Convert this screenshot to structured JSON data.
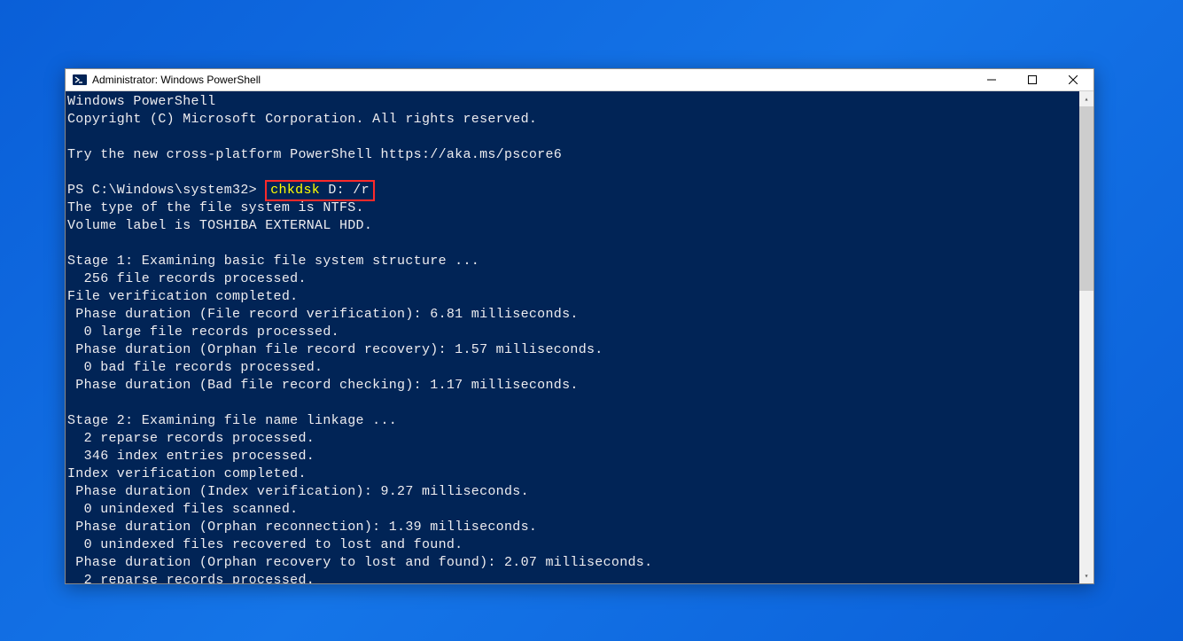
{
  "window": {
    "title": "Administrator: Windows PowerShell"
  },
  "terminal": {
    "line1": "Windows PowerShell",
    "line2": "Copyright (C) Microsoft Corporation. All rights reserved.",
    "line3": "Try the new cross-platform PowerShell https://aka.ms/pscore6",
    "prompt": "PS C:\\Windows\\system32> ",
    "cmd_name": "chkdsk",
    "cmd_args": " D: /r",
    "out1": "The type of the file system is NTFS.",
    "out2": "Volume label is TOSHIBA EXTERNAL HDD.",
    "s1_title": "Stage 1: Examining basic file system structure ...",
    "s1_l1": "  256 file records processed.",
    "s1_l2": "File verification completed.",
    "s1_l3": " Phase duration (File record verification): 6.81 milliseconds.",
    "s1_l4": "  0 large file records processed.",
    "s1_l5": " Phase duration (Orphan file record recovery): 1.57 milliseconds.",
    "s1_l6": "  0 bad file records processed.",
    "s1_l7": " Phase duration (Bad file record checking): 1.17 milliseconds.",
    "s2_title": "Stage 2: Examining file name linkage ...",
    "s2_l1": "  2 reparse records processed.",
    "s2_l2": "  346 index entries processed.",
    "s2_l3": "Index verification completed.",
    "s2_l4": " Phase duration (Index verification): 9.27 milliseconds.",
    "s2_l5": "  0 unindexed files scanned.",
    "s2_l6": " Phase duration (Orphan reconnection): 1.39 milliseconds.",
    "s2_l7": "  0 unindexed files recovered to lost and found.",
    "s2_l8": " Phase duration (Orphan recovery to lost and found): 2.07 milliseconds.",
    "s2_l9": "  2 reparse records processed."
  }
}
